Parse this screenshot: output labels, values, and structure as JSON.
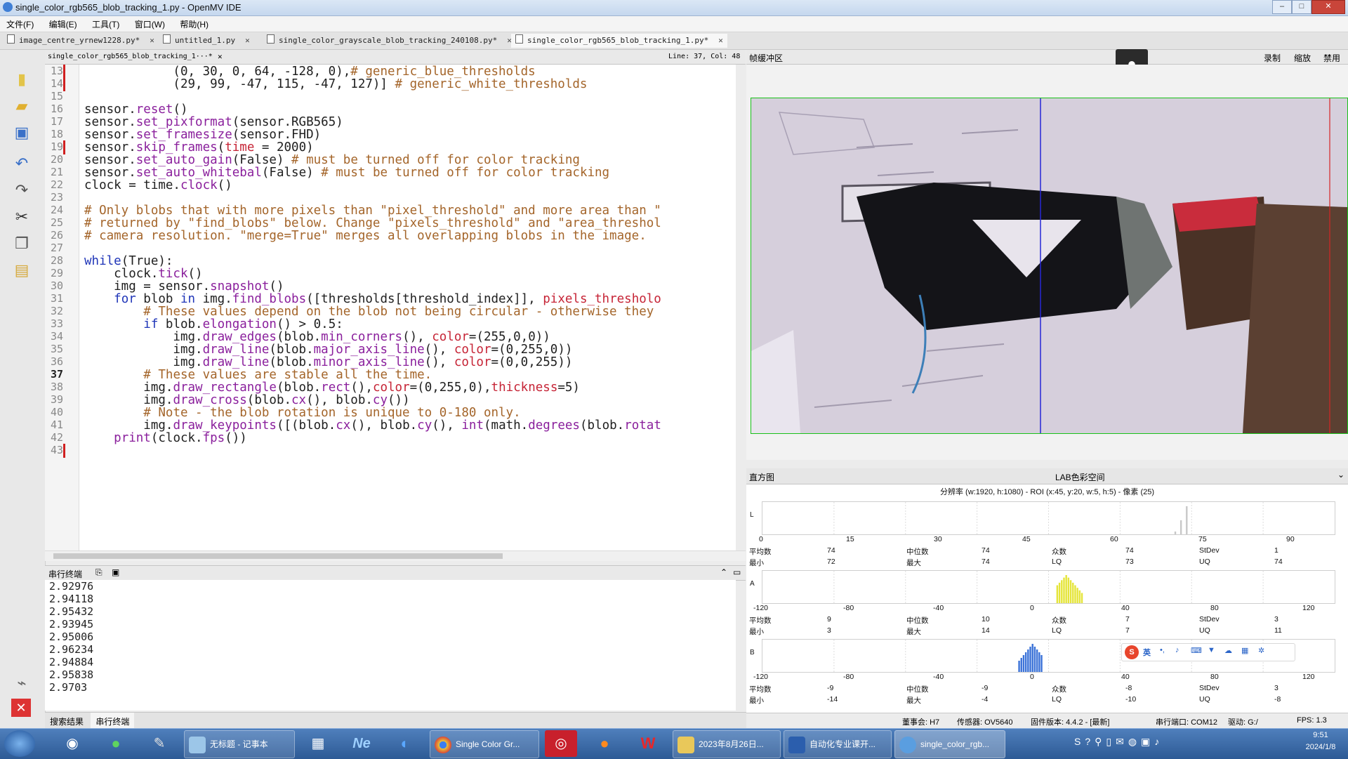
{
  "window": {
    "title": "single_color_rgb565_blob_tracking_1.py - OpenMV IDE",
    "controls": [
      "–",
      "□",
      "✕"
    ]
  },
  "menu": [
    "文件(F)",
    "编辑(E)",
    "工具(T)",
    "窗口(W)",
    "帮助(H)"
  ],
  "tabs": [
    {
      "label": "image_centre_yrnew1228.py*"
    },
    {
      "label": "untitled_1.py"
    },
    {
      "label": "single_color_grayscale_blob_tracking_240108.py*"
    },
    {
      "label": "single_color_rgb565_blob_tracking_1.py*"
    }
  ],
  "editor_header": {
    "file": "single_color_rgb565_blob_tracking_1···*",
    "position": "Line: 37, Col: 48"
  },
  "code": {
    "line_numbers": [
      "13",
      "14",
      "15",
      "16",
      "17",
      "18",
      "19",
      "20",
      "21",
      "22",
      "23",
      "24",
      "25",
      "26",
      "27",
      "28",
      "29",
      "30",
      "31",
      "32",
      "33",
      "34",
      "35",
      "36",
      "37",
      "38",
      "39",
      "40",
      "41",
      "42",
      "43"
    ],
    "current_line": "37"
  },
  "serial": {
    "title": "串行终端",
    "lines": [
      "2.92976",
      "2.94118",
      "2.95432",
      "2.93945",
      "2.95006",
      "2.96234",
      "2.94884",
      "2.95838",
      "2.9703"
    ]
  },
  "bottom_tabs": [
    "搜索结果",
    "串行终端"
  ],
  "frame_buffer": {
    "title": "帧缓冲区",
    "record": "录制",
    "zoom": "缩放",
    "disable": "禁用"
  },
  "histogram": {
    "title": "直方图",
    "colorspace": "LAB色彩空间",
    "info": "分辨率 (w:1920, h:1080) - ROI (x:45, y:20, w:5, h:5) - 像素 (25)",
    "channels": [
      {
        "label": "L",
        "ticks": [
          "0",
          "15",
          "30",
          "45",
          "60",
          "75",
          "90"
        ],
        "mean": "74",
        "median": "74",
        "mode": "74",
        "stdev": "1",
        "min": "72",
        "max": "74",
        "lq": "73",
        "uq": "74",
        "peak_color": "#c8c8c8"
      },
      {
        "label": "A",
        "ticks": [
          "-120",
          "-80",
          "-40",
          "0",
          "40",
          "80",
          "120"
        ],
        "mean": "9",
        "median": "10",
        "mode": "7",
        "stdev": "3",
        "min": "3",
        "max": "14",
        "lq": "7",
        "uq": "11",
        "peak_color": "#e5e53a"
      },
      {
        "label": "B",
        "ticks": [
          "-120",
          "-80",
          "-40",
          "0",
          "40",
          "80",
          "120"
        ],
        "mean": "-9",
        "median": "-9",
        "mode": "-8",
        "stdev": "3",
        "min": "-14",
        "max": "-4",
        "lq": "-10",
        "uq": "-8",
        "peak_color": "#3a72d8"
      }
    ],
    "stat_labels": {
      "mean": "平均数",
      "median": "中位数",
      "mode": "众数",
      "stdev": "StDev",
      "min": "最小",
      "max": "最大",
      "lq": "LQ",
      "uq": "UQ"
    }
  },
  "statusbar": {
    "board": "董事会: H7",
    "sensor": "传感器: OV5640",
    "firmware": "固件版本: 4.4.2 - [最新]",
    "port": "串行端口: COM12",
    "drive": "驱动: G:/",
    "fps": "FPS:   1.3"
  },
  "ime": {
    "label": "英"
  },
  "taskbar": {
    "tasks": [
      "无标题 - 记事本",
      "Single Color Gr...",
      "2023年8月26日...",
      "自动化专业课开...",
      "single_color_rgb..."
    ],
    "time": "9:51",
    "date": "2024/1/8"
  },
  "colors": {
    "keyword": "#1f35b8",
    "function": "#8a1f9c",
    "comment": "#a4652a",
    "param": "#c62436",
    "roi_green": "#19c119"
  }
}
